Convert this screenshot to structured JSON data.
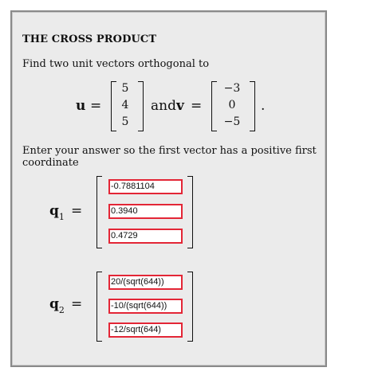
{
  "section_title": "THE CROSS PRODUCT",
  "prompt": "Find two unit vectors orthogonal to",
  "vectors": {
    "u_name": "u",
    "v_name": "v",
    "equals": "=",
    "and_text": "and",
    "period": ".",
    "u": [
      "5",
      "4",
      "5"
    ],
    "v": [
      "−3",
      "0",
      "−5"
    ]
  },
  "instruction": "Enter your answer so the first vector has a positive first coordinate",
  "answers": {
    "q1": {
      "name": "q",
      "subscript": "1",
      "equals": "=",
      "values": [
        "-0.7881104",
        "0.3940",
        "0.4729"
      ]
    },
    "q2": {
      "name": "q",
      "subscript": "2",
      "equals": "=",
      "values": [
        "20/(sqrt(644))",
        "-10/(sqrt(644))",
        "-12/sqrt(644)"
      ]
    }
  },
  "field_border_color": "#e32636"
}
